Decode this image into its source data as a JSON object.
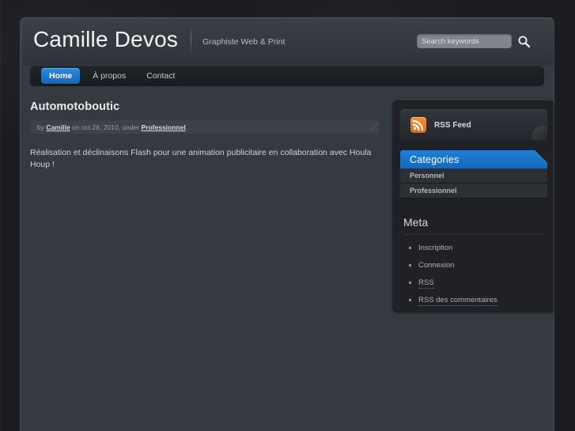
{
  "header": {
    "site_title": "Camille Devos",
    "tagline": "Graphiste Web & Print",
    "search": {
      "placeholder": "Search keywords",
      "value": "",
      "button_icon": "search-icon"
    }
  },
  "nav": {
    "items": [
      {
        "label": "Home",
        "active": true
      },
      {
        "label": "À propos",
        "active": false
      },
      {
        "label": "Contact",
        "active": false
      }
    ]
  },
  "post": {
    "title": "Automotoboutic",
    "meta": {
      "by_prefix": "by",
      "author": "Camille",
      "on_prefix": "on",
      "date": "oct.28, 2010,",
      "under_prefix": "under",
      "category": "Professionnel"
    },
    "body": "Réalisation et déclinaisons Flash pour une animation publicitaire en collaboration avec Houla Houp !"
  },
  "sidebar": {
    "rss": {
      "label": "RSS Feed",
      "icon": "rss-icon"
    },
    "categories": {
      "heading": "Categories",
      "items": [
        "Personnel",
        "Professionnel"
      ]
    },
    "meta": {
      "heading": "Meta",
      "items": [
        "Inscription",
        "Connexion",
        "RSS",
        "RSS des commentaires"
      ]
    }
  },
  "colors": {
    "accent_blue": "#1f7ed0",
    "rss_orange": "#e8760f",
    "page_bg": "#353940",
    "sidebar_bg": "#1f2126",
    "outer_bg": "#1a1c20"
  }
}
